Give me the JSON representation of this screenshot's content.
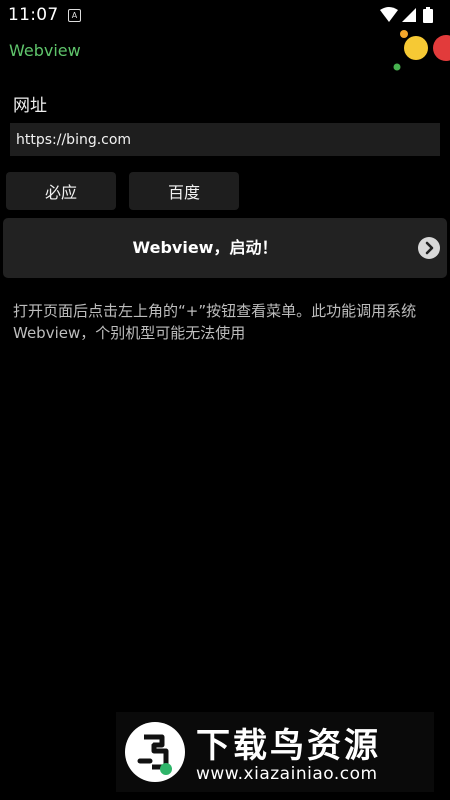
{
  "status_bar": {
    "time": "11:07",
    "notification_badge": "A",
    "icons": [
      "wifi-icon",
      "cellular-signal-icon",
      "battery-icon"
    ]
  },
  "app": {
    "title": "Webview",
    "title_color": "#5fc46b"
  },
  "form": {
    "url_label": "网址",
    "url_value": "https://bing.com"
  },
  "buttons": {
    "bing": "必应",
    "baidu": "百度"
  },
  "launch": {
    "label": "Webview，启动！",
    "arrow_icon": "chevron-right-icon"
  },
  "description": "打开页面后点击左上角的“+”按钮查看菜单。此功能调用系统Webview，个别机型可能无法使用",
  "watermark": {
    "title": "下载鸟资源",
    "url": "www.xiazainiao.com"
  }
}
